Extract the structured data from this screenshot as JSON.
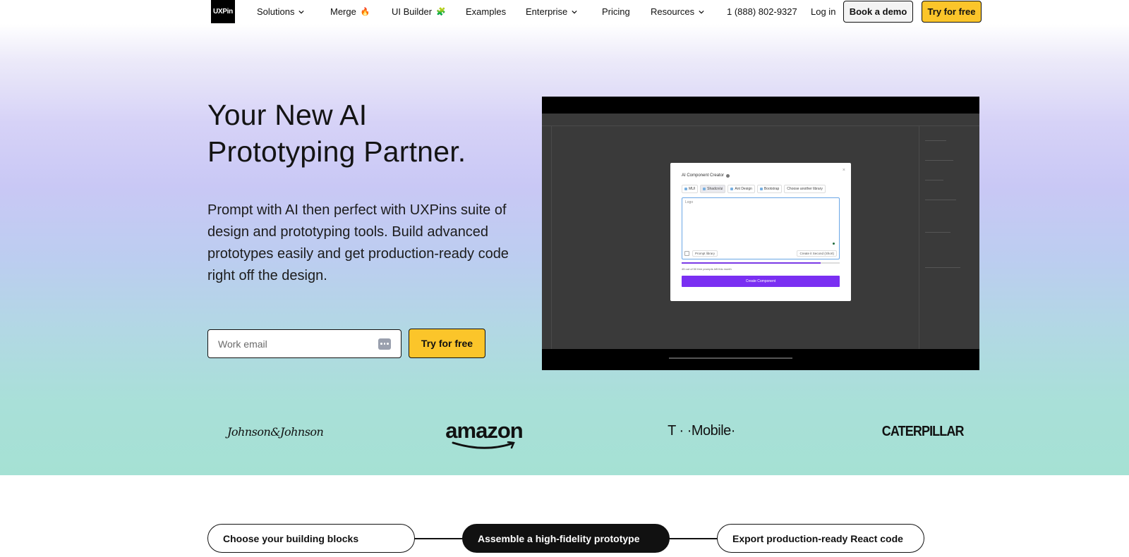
{
  "nav": {
    "logo_text": "UXPin",
    "items": [
      {
        "label": "Solutions",
        "has_dropdown": true
      },
      {
        "label": "Merge",
        "emoji": "🔥"
      },
      {
        "label": "UI Builder",
        "emoji": "🧩"
      },
      {
        "label": "Examples"
      },
      {
        "label": "Enterprise",
        "has_dropdown": true
      },
      {
        "label": "Pricing"
      },
      {
        "label": "Resources",
        "has_dropdown": true
      },
      {
        "label": "1 (888) 802-9327"
      },
      {
        "label": "Log in"
      }
    ],
    "book_demo_label": "Book a demo",
    "try_free_label": "Try for free"
  },
  "hero": {
    "title_line1": "Your New AI",
    "title_line2": "Prototyping Partner.",
    "description": "Prompt with AI then perfect with UXPins suite of design and prototyping tools. Build advanced prototypes easily and get production-ready code right off the design.",
    "email_placeholder": "Work email",
    "try_free_label": "Try for free"
  },
  "video": {
    "modal_title": "AI Component Creator",
    "close_glyph": "×",
    "library_tabs": [
      "MUI",
      "Shadcn/ui",
      "Ant Design",
      "Bootstrap",
      "Choose another library"
    ],
    "active_tab_index": 1,
    "prompt_placeholder": "Logo",
    "prompt_library_label": "Prompt library",
    "model_select_label": "Create it Second (Short)",
    "progress_fraction": 0.88,
    "usage_text": "45 out of 50 free prompts left this month",
    "create_button_label": "Create Component"
  },
  "logos": {
    "johnson": "Johnson&Johnson",
    "amazon": "amazon",
    "tmobile": "T · ·Mobile·",
    "caterpillar": "CATERPILLAR"
  },
  "steps": [
    {
      "label": "Choose your building blocks",
      "active": false
    },
    {
      "label": "Assemble a high-fidelity prototype",
      "active": true
    },
    {
      "label": "Export production-ready React code",
      "active": false
    }
  ],
  "colors": {
    "accent_yellow": "#fbc52a",
    "create_button_purple": "#7a2ff2",
    "hero_gradient_top": "#d6d2f7",
    "hero_gradient_bottom": "#a5e1d4"
  }
}
